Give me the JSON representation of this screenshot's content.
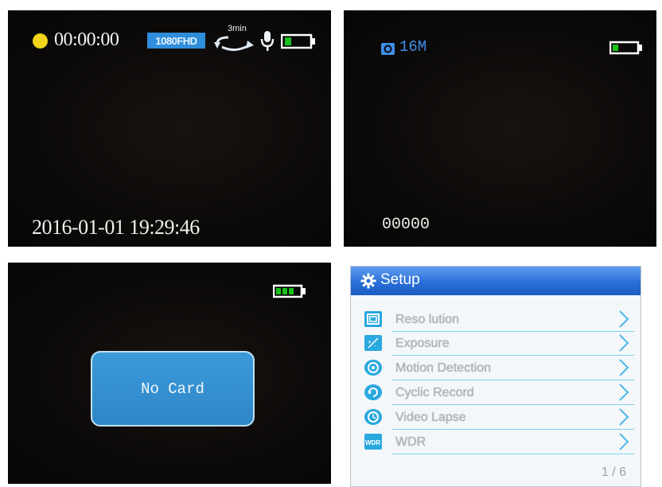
{
  "video_screen": {
    "timer": "00:00:00",
    "resolution_badge": "1080FHD",
    "loop_label": "3min",
    "datetime": "2016-01-01  19:29:46",
    "rec_dot_color": "#f2d51a",
    "icons": [
      "record-dot-icon",
      "loop-record-icon",
      "microphone-icon",
      "battery-full-icon"
    ]
  },
  "photo_screen": {
    "megapixels": "16M",
    "counter": "00000",
    "icons": [
      "camera-icon",
      "battery-icon"
    ]
  },
  "nocard_screen": {
    "message": "No Card",
    "icons": [
      "battery-charging-icon"
    ]
  },
  "setup_menu": {
    "title": "Setup",
    "items": [
      {
        "label": "Reso lution",
        "icon": "resolution-icon"
      },
      {
        "label": "Exposure",
        "icon": "exposure-icon"
      },
      {
        "label": "Motion Detection",
        "icon": "motion-detection-icon"
      },
      {
        "label": "Cyclic Record",
        "icon": "cyclic-record-icon"
      },
      {
        "label": "Video Lapse",
        "icon": "clock-icon"
      },
      {
        "label": "WDR",
        "icon": "wdr-icon"
      }
    ],
    "page_indicator": "1 / 6",
    "accent_color": "#2a6fd8",
    "icon_color": "#29a8df"
  }
}
